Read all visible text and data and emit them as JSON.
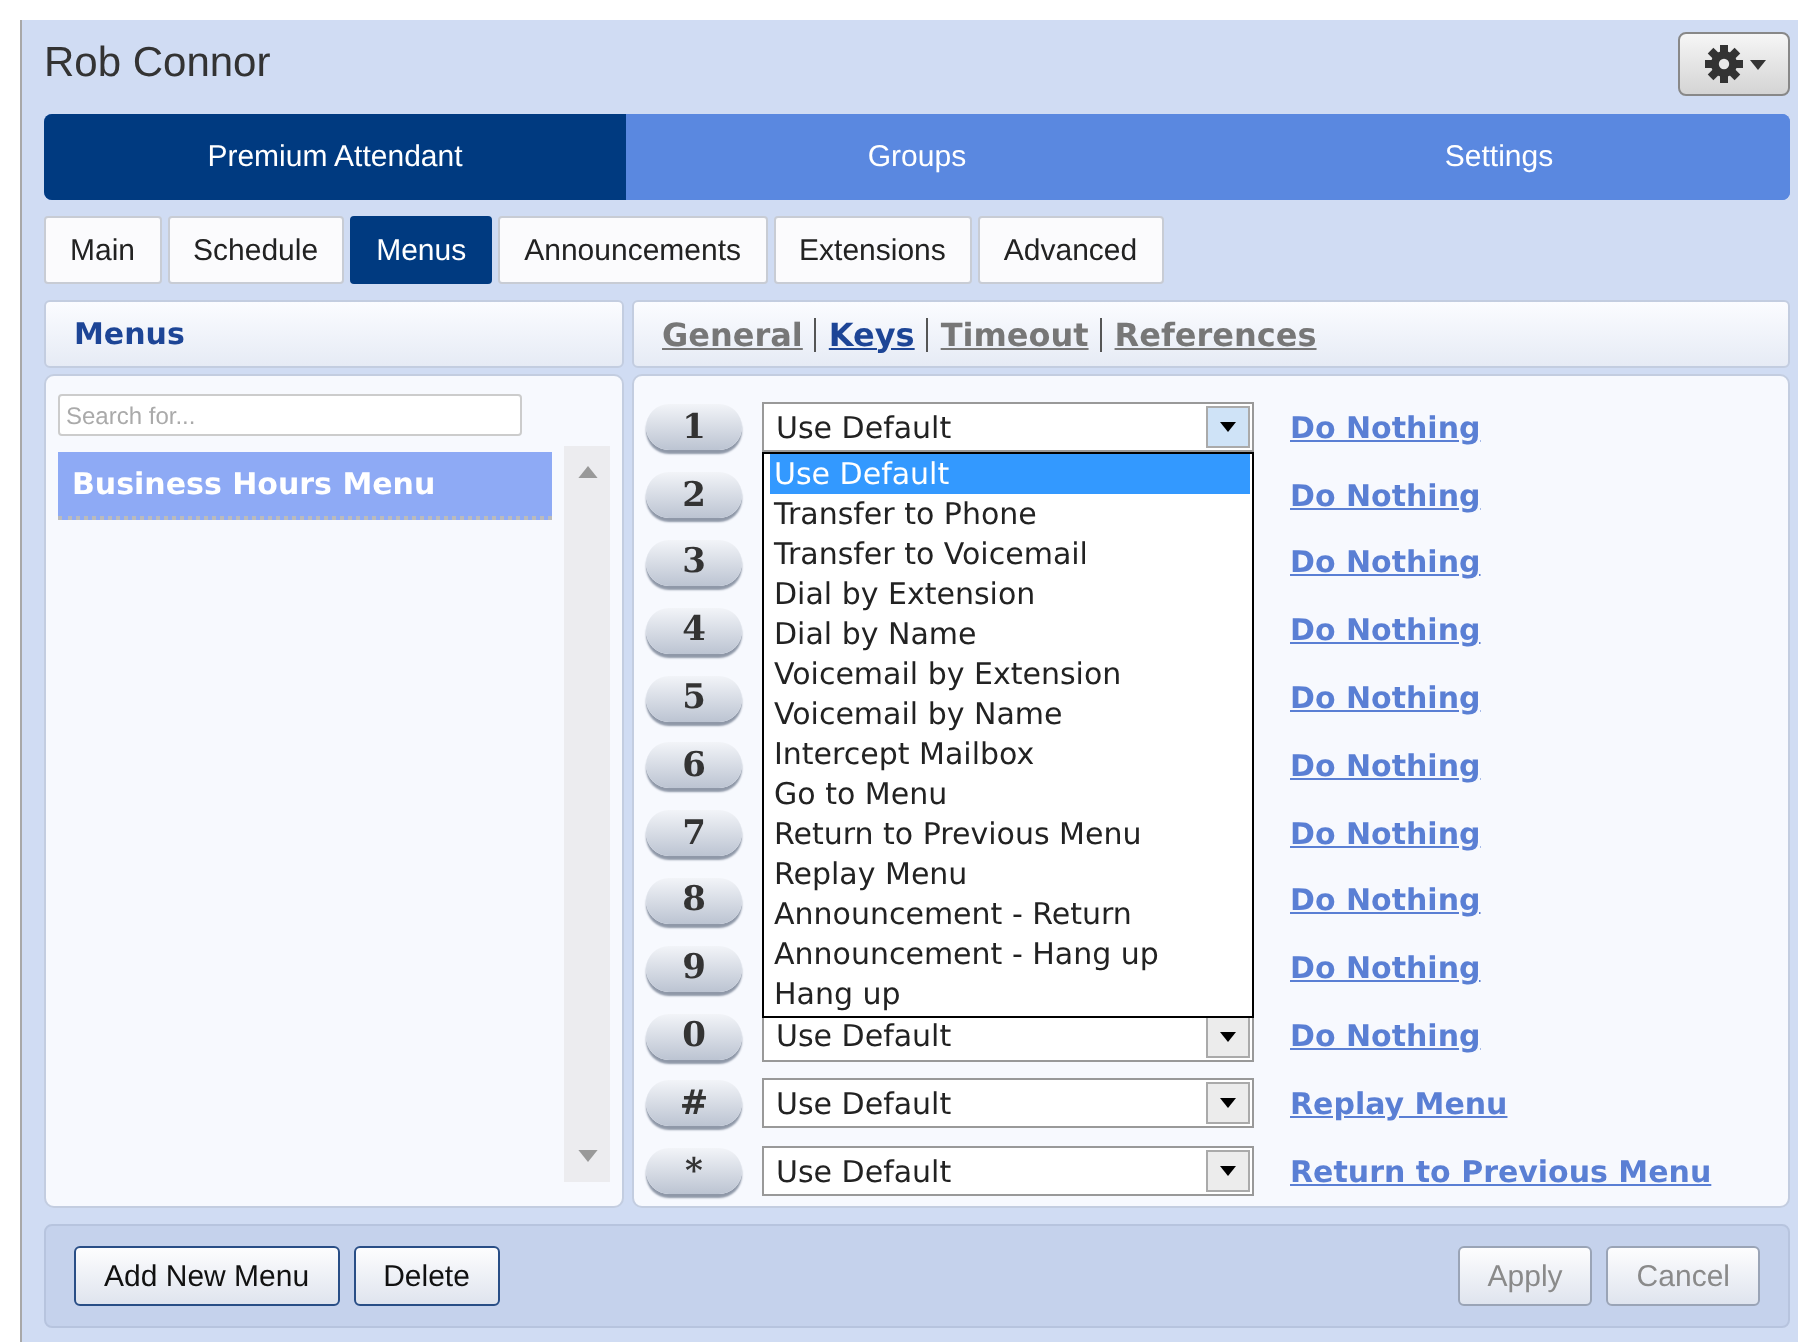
{
  "title": "Rob Connor",
  "nav_tabs": [
    {
      "label": "Premium Attendant",
      "selected": true
    },
    {
      "label": "Groups",
      "selected": false
    },
    {
      "label": "Settings",
      "selected": false
    }
  ],
  "sub_tabs": [
    {
      "label": "Main",
      "selected": false
    },
    {
      "label": "Schedule",
      "selected": false
    },
    {
      "label": "Menus",
      "selected": true
    },
    {
      "label": "Announcements",
      "selected": false
    },
    {
      "label": "Extensions",
      "selected": false
    },
    {
      "label": "Advanced",
      "selected": false
    }
  ],
  "menus_panel": {
    "title": "Menus",
    "search": {
      "placeholder": "Search for..."
    },
    "items": [
      {
        "label": "Business Hours Menu",
        "selected": true
      }
    ]
  },
  "keys_panel": {
    "links": [
      {
        "label": "General",
        "selected": false
      },
      {
        "label": "Keys",
        "selected": true
      },
      {
        "label": "Timeout",
        "selected": false
      },
      {
        "label": "References",
        "selected": false
      }
    ],
    "rows": [
      {
        "key": "1",
        "select": "Use Default",
        "action": "Do Nothing",
        "open": true,
        "options": [
          {
            "label": "Use Default",
            "selected": true
          },
          {
            "label": "Transfer to Phone",
            "selected": false
          },
          {
            "label": "Transfer to Voicemail",
            "selected": false
          },
          {
            "label": "Dial by Extension",
            "selected": false
          },
          {
            "label": "Dial by Name",
            "selected": false
          },
          {
            "label": "Voicemail by Extension",
            "selected": false
          },
          {
            "label": "Voicemail by Name",
            "selected": false
          },
          {
            "label": "Intercept Mailbox",
            "selected": false
          },
          {
            "label": "Go to Menu",
            "selected": false
          },
          {
            "label": "Return to Previous Menu",
            "selected": false
          },
          {
            "label": "Replay Menu",
            "selected": false
          },
          {
            "label": "Announcement - Return",
            "selected": false
          },
          {
            "label": "Announcement - Hang up",
            "selected": false
          },
          {
            "label": "Hang up",
            "selected": false
          }
        ]
      },
      {
        "key": "2",
        "action": "Do Nothing"
      },
      {
        "key": "3",
        "action": "Do Nothing"
      },
      {
        "key": "4",
        "action": "Do Nothing"
      },
      {
        "key": "5",
        "action": "Do Nothing"
      },
      {
        "key": "6",
        "action": "Do Nothing"
      },
      {
        "key": "7",
        "action": "Do Nothing"
      },
      {
        "key": "8",
        "action": "Do Nothing"
      },
      {
        "key": "9",
        "action": "Do Nothing"
      },
      {
        "key": "0",
        "select": "Use Default",
        "action": "Do Nothing"
      },
      {
        "key": "#",
        "select": "Use Default",
        "action": "Replay Menu"
      },
      {
        "key": "*",
        "select": "Use Default",
        "action": "Return to Previous Menu"
      }
    ]
  },
  "footer": {
    "left_buttons": [
      {
        "label": "Add New Menu",
        "disabled": false
      },
      {
        "label": "Delete",
        "disabled": false
      }
    ],
    "right_buttons": [
      {
        "label": "Apply",
        "disabled": true
      },
      {
        "label": "Cancel",
        "disabled": true
      }
    ]
  }
}
